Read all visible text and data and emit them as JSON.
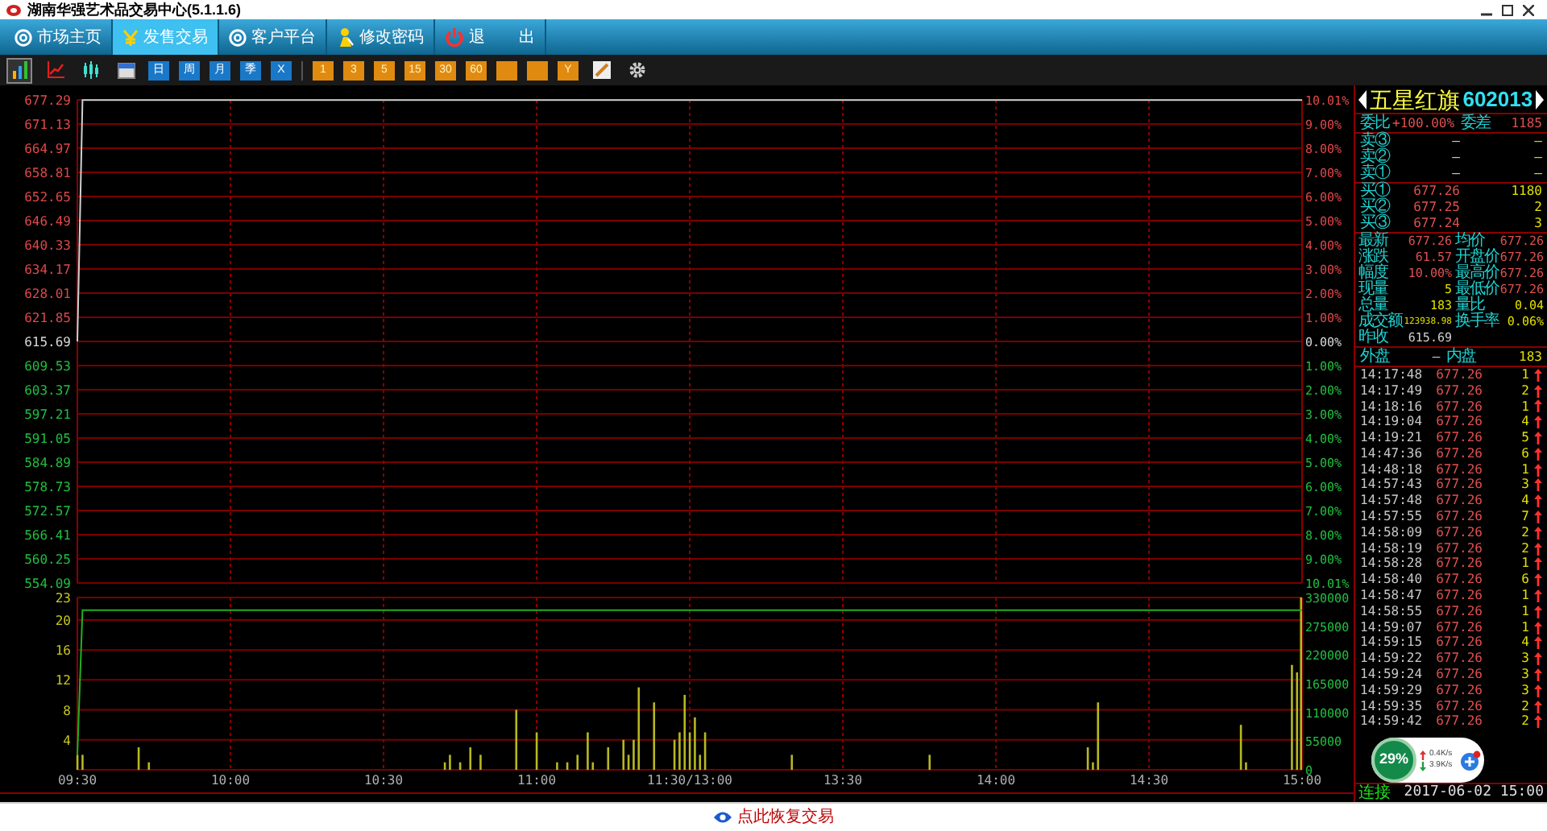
{
  "window": {
    "title": "湖南华强艺术品交易中心(5.1.1.6)"
  },
  "nav": [
    {
      "label": "市场主页",
      "selected": false
    },
    {
      "label": "发售交易",
      "selected": true
    },
    {
      "label": "客户平台",
      "selected": false
    },
    {
      "label": "修改密码",
      "selected": false
    },
    {
      "label": "退 出",
      "selected": false
    }
  ],
  "toolbar": [
    {
      "kind": "bars",
      "selected": true
    },
    {
      "kind": "line",
      "selected": false
    },
    {
      "kind": "candles",
      "selected": false
    },
    {
      "kind": "calendar",
      "selected": false
    },
    {
      "kind": "blue",
      "label": "日",
      "selected": false
    },
    {
      "kind": "blue",
      "label": "周",
      "selected": false
    },
    {
      "kind": "blue",
      "label": "月",
      "selected": false
    },
    {
      "kind": "blue",
      "label": "季",
      "selected": false
    },
    {
      "kind": "blue",
      "label": "X",
      "selected": false
    },
    {
      "kind": "orange",
      "label": "1",
      "selected": false
    },
    {
      "kind": "orange",
      "label": "3",
      "selected": false
    },
    {
      "kind": "orange",
      "label": "5",
      "selected": false
    },
    {
      "kind": "orange",
      "label": "15",
      "selected": false
    },
    {
      "kind": "orange",
      "label": "30",
      "selected": false
    },
    {
      "kind": "orange",
      "label": "60",
      "selected": false
    },
    {
      "kind": "orange",
      "selected": false
    },
    {
      "kind": "orange",
      "selected": false
    },
    {
      "kind": "orange",
      "label": "Y",
      "selected": false
    },
    {
      "kind": "draw",
      "selected": false
    },
    {
      "kind": "gear",
      "selected": false
    }
  ],
  "price_chart": {
    "chart_data": {
      "type": "line",
      "series": [
        {
          "color": "#d0d0d0",
          "values": [
            615.69,
            677.26,
            677.26,
            677.26,
            677.26,
            677.26,
            677.26,
            677.26,
            677.26,
            677.26,
            677.26,
            677.26,
            677.26,
            677.26,
            677.26,
            677.26,
            677.26,
            677.26,
            677.26,
            677.26,
            677.26,
            677.26,
            677.26,
            677.26,
            677.26,
            677.26,
            677.26,
            677.26,
            677.26,
            677.26,
            677.26,
            677.26,
            677.26,
            677.26,
            677.26,
            677.26,
            677.26,
            677.26,
            677.26,
            677.26,
            677.26,
            677.26,
            677.26,
            677.26,
            677.26,
            677.26,
            677.26,
            677.26,
            677.26,
            677.26,
            677.26,
            677.26,
            677.26,
            677.26,
            677.26,
            677.26,
            677.26,
            677.26,
            677.26,
            677.26,
            677.26,
            677.26,
            677.26,
            677.26,
            677.26,
            677.26,
            677.26,
            677.26,
            677.26,
            677.26,
            677.26,
            677.26,
            677.26,
            677.26,
            677.26,
            677.26,
            677.26,
            677.26,
            677.26,
            677.26,
            677.26,
            677.26,
            677.26,
            677.26,
            677.26,
            677.26,
            677.26,
            677.26,
            677.26,
            677.26,
            677.26,
            677.26,
            677.26,
            677.26,
            677.26,
            677.26,
            677.26,
            677.26,
            677.26,
            677.26,
            677.26,
            677.26,
            677.26,
            677.26,
            677.26,
            677.26,
            677.26,
            677.26,
            677.26,
            677.26,
            677.26,
            677.26,
            677.26,
            677.26,
            677.26,
            677.26,
            677.26,
            677.26,
            677.26,
            677.26,
            677.26,
            677.26,
            677.26,
            677.26,
            677.26,
            677.26,
            677.26,
            677.26,
            677.26,
            677.26,
            677.26,
            677.26,
            677.26,
            677.26,
            677.26,
            677.26,
            677.26,
            677.26,
            677.26,
            677.26,
            677.26,
            677.26,
            677.26,
            677.26,
            677.26,
            677.26,
            677.26,
            677.26,
            677.26,
            677.26,
            677.26,
            677.26,
            677.26,
            677.26,
            677.26,
            677.26,
            677.26,
            677.26,
            677.26,
            677.26,
            677.26,
            677.26,
            677.26,
            677.26,
            677.26,
            677.26,
            677.26,
            677.26,
            677.26,
            677.26,
            677.26,
            677.26,
            677.26,
            677.26,
            677.26,
            677.26,
            677.26,
            677.26,
            677.26,
            677.26,
            677.26,
            677.26,
            677.26,
            677.26,
            677.26,
            677.26,
            677.26,
            677.26,
            677.26,
            677.26,
            677.26,
            677.26,
            677.26,
            677.26,
            677.26,
            677.26,
            677.26,
            677.26,
            677.26,
            677.26,
            677.26,
            677.26,
            677.26,
            677.26,
            677.26,
            677.26,
            677.26,
            677.26,
            677.26,
            677.26,
            677.26,
            677.26,
            677.26,
            677.26,
            677.26,
            677.26,
            677.26,
            677.26,
            677.26,
            677.26,
            677.26,
            677.26,
            677.26,
            677.26,
            677.26,
            677.26,
            677.26,
            677.26,
            677.26,
            677.26,
            677.26,
            677.26,
            677.26,
            677.26,
            677.26,
            677.26,
            677.26,
            677.26,
            677.26,
            677.26,
            677.26
          ]
        }
      ],
      "ylim": [
        554.09,
        677.29
      ],
      "grid": true,
      "yticks": [
        {
          "value": 677.29,
          "label": "677.29"
        },
        {
          "value": 671.13,
          "label": "671.13"
        },
        {
          "value": 664.97,
          "label": "664.97"
        },
        {
          "value": 658.81,
          "label": "658.81"
        },
        {
          "value": 652.65,
          "label": "652.65"
        },
        {
          "value": 646.49,
          "label": "646.49"
        },
        {
          "value": 640.33,
          "label": "640.33"
        },
        {
          "value": 634.17,
          "label": "634.17"
        },
        {
          "value": 628.01,
          "label": "628.01"
        },
        {
          "value": 621.85,
          "label": "621.85"
        },
        {
          "value": 615.69,
          "label": "615.69"
        },
        {
          "value": 609.53,
          "label": "609.53"
        },
        {
          "value": 603.37,
          "label": "603.37"
        },
        {
          "value": 597.21,
          "label": "597.21"
        },
        {
          "value": 591.05,
          "label": "591.05"
        },
        {
          "value": 584.89,
          "label": "584.89"
        },
        {
          "value": 578.73,
          "label": "578.73"
        },
        {
          "value": 572.57,
          "label": "572.57"
        },
        {
          "value": 566.41,
          "label": "566.41"
        },
        {
          "value": 560.25,
          "label": "560.25"
        },
        {
          "value": 554.09,
          "label": "554.09"
        }
      ]
    },
    "right_axis": [
      "10.01%",
      "9.00%",
      "8.00%",
      "7.00%",
      "6.00%",
      "5.00%",
      "4.00%",
      "3.00%",
      "2.00%",
      "1.00%",
      "0.00%",
      "1.00%",
      "2.00%",
      "3.00%",
      "4.00%",
      "5.00%",
      "6.00%",
      "7.00%",
      "8.00%",
      "9.00%",
      "10.01%"
    ]
  },
  "volume_chart": {
    "chart_data": {
      "type": "bar",
      "categories": [
        "09:30",
        null,
        null,
        null,
        null,
        null,
        null,
        null,
        null,
        null,
        null,
        null,
        null,
        null,
        null,
        null,
        null,
        null,
        null,
        null,
        null,
        null,
        null,
        null,
        null,
        null,
        null,
        null,
        null,
        null,
        "10:00",
        null,
        null,
        null,
        null,
        null,
        null,
        null,
        null,
        null,
        null,
        null,
        null,
        null,
        null,
        null,
        null,
        null,
        null,
        null,
        null,
        null,
        null,
        null,
        null,
        null,
        null,
        null,
        null,
        null,
        "10:30",
        null,
        null,
        null,
        null,
        null,
        null,
        null,
        null,
        null,
        null,
        null,
        null,
        null,
        null,
        null,
        null,
        null,
        null,
        null,
        null,
        null,
        null,
        null,
        null,
        null,
        null,
        null,
        null,
        null,
        "11:00",
        null,
        null,
        null,
        null,
        null,
        null,
        null,
        null,
        null,
        null,
        null,
        null,
        null,
        null,
        null,
        null,
        null,
        null,
        null,
        null,
        null,
        null,
        null,
        null,
        null,
        null,
        null,
        null,
        null,
        "11:30/13:00",
        null,
        null,
        null,
        null,
        null,
        null,
        null,
        null,
        null,
        null,
        null,
        null,
        null,
        null,
        null,
        null,
        null,
        null,
        null,
        null,
        null,
        null,
        null,
        null,
        null,
        null,
        null,
        null,
        null,
        "13:30",
        null,
        null,
        null,
        null,
        null,
        null,
        null,
        null,
        null,
        null,
        null,
        null,
        null,
        null,
        null,
        null,
        null,
        null,
        null,
        null,
        null,
        null,
        null,
        null,
        null,
        null,
        null,
        null,
        null,
        "14:00",
        null,
        null,
        null,
        null,
        null,
        null,
        null,
        null,
        null,
        null,
        null,
        null,
        null,
        null,
        null,
        null,
        null,
        null,
        null,
        null,
        null,
        null,
        null,
        null,
        null,
        null,
        null,
        null,
        null,
        "14:30",
        null,
        null,
        null,
        null,
        null,
        null,
        null,
        null,
        null,
        null,
        null,
        null,
        null,
        null,
        null,
        null,
        null,
        null,
        null,
        null,
        null,
        null,
        null,
        null,
        null,
        null,
        null,
        null,
        null,
        "15:00"
      ],
      "series": [
        {
          "type": "bar",
          "color": "#b8b820",
          "values": [
            2,
            2,
            null,
            null,
            null,
            null,
            null,
            null,
            null,
            null,
            null,
            null,
            3,
            null,
            1,
            null,
            null,
            null,
            null,
            null,
            null,
            null,
            null,
            null,
            null,
            null,
            null,
            null,
            null,
            null,
            null,
            null,
            null,
            null,
            null,
            null,
            null,
            null,
            null,
            null,
            null,
            null,
            null,
            null,
            null,
            null,
            null,
            null,
            null,
            null,
            null,
            null,
            null,
            null,
            null,
            null,
            null,
            null,
            null,
            null,
            null,
            null,
            null,
            null,
            null,
            null,
            null,
            null,
            null,
            null,
            null,
            null,
            1,
            2,
            null,
            1,
            null,
            3,
            null,
            2,
            null,
            null,
            null,
            null,
            null,
            null,
            8,
            null,
            null,
            null,
            5,
            null,
            null,
            null,
            1,
            null,
            1,
            null,
            2,
            null,
            5,
            1,
            null,
            null,
            3,
            null,
            null,
            4,
            2,
            4,
            11,
            null,
            null,
            9,
            null,
            null,
            null,
            4,
            5,
            10,
            5,
            7,
            2,
            5,
            null,
            null,
            null,
            null,
            null,
            null,
            null,
            null,
            null,
            null,
            null,
            null,
            null,
            null,
            null,
            null,
            2,
            null,
            null,
            null,
            null,
            null,
            null,
            null,
            null,
            null,
            null,
            null,
            null,
            null,
            null,
            null,
            null,
            null,
            null,
            null,
            null,
            null,
            null,
            null,
            null,
            null,
            null,
            2,
            null,
            null,
            null,
            null,
            null,
            null,
            null,
            null,
            null,
            null,
            null,
            null,
            null,
            null,
            null,
            null,
            null,
            null,
            null,
            null,
            null,
            null,
            null,
            null,
            null,
            null,
            null,
            null,
            null,
            null,
            3,
            1,
            9,
            null,
            null,
            null,
            null,
            null,
            null,
            null,
            null,
            null,
            null,
            null,
            null,
            null,
            null,
            null,
            null,
            null,
            null,
            null,
            null,
            null,
            null,
            null,
            null,
            null,
            null,
            null,
            6,
            1,
            null,
            null,
            null,
            null,
            null,
            null,
            null,
            null,
            14,
            13,
            23
          ]
        },
        {
          "type": "line",
          "color": "#20b020",
          "values": [
            2,
            21.3,
            21.3,
            21.3,
            21.3,
            21.3,
            21.3,
            21.3,
            21.3,
            21.3,
            21.3,
            21.3,
            21.3,
            21.3,
            21.3,
            21.3,
            21.3,
            21.3,
            21.3,
            21.3,
            21.3,
            21.3,
            21.3,
            21.3,
            21.3,
            21.3,
            21.3,
            21.3,
            21.3,
            21.3,
            21.3,
            21.3,
            21.3,
            21.3,
            21.3,
            21.3,
            21.3,
            21.3,
            21.3,
            21.3,
            21.3,
            21.3,
            21.3,
            21.3,
            21.3,
            21.3,
            21.3,
            21.3,
            21.3,
            21.3,
            21.3,
            21.3,
            21.3,
            21.3,
            21.3,
            21.3,
            21.3,
            21.3,
            21.3,
            21.3,
            21.3,
            21.3,
            21.3,
            21.3,
            21.3,
            21.3,
            21.3,
            21.3,
            21.3,
            21.3,
            21.3,
            21.3,
            21.3,
            21.3,
            21.3,
            21.3,
            21.3,
            21.3,
            21.3,
            21.3,
            21.3,
            21.3,
            21.3,
            21.3,
            21.3,
            21.3,
            21.3,
            21.3,
            21.3,
            21.3,
            21.3,
            21.3,
            21.3,
            21.3,
            21.3,
            21.3,
            21.3,
            21.3,
            21.3,
            21.3,
            21.3,
            21.3,
            21.3,
            21.3,
            21.3,
            21.3,
            21.3,
            21.3,
            21.3,
            21.3,
            21.3,
            21.3,
            21.3,
            21.3,
            21.3,
            21.3,
            21.3,
            21.3,
            21.3,
            21.3,
            21.3,
            21.3,
            21.3,
            21.3,
            21.3,
            21.3,
            21.3,
            21.3,
            21.3,
            21.3,
            21.3,
            21.3,
            21.3,
            21.3,
            21.3,
            21.3,
            21.3,
            21.3,
            21.3,
            21.3,
            21.3,
            21.3,
            21.3,
            21.3,
            21.3,
            21.3,
            21.3,
            21.3,
            21.3,
            21.3,
            21.3,
            21.3,
            21.3,
            21.3,
            21.3,
            21.3,
            21.3,
            21.3,
            21.3,
            21.3,
            21.3,
            21.3,
            21.3,
            21.3,
            21.3,
            21.3,
            21.3,
            21.3,
            21.3,
            21.3,
            21.3,
            21.3,
            21.3,
            21.3,
            21.3,
            21.3,
            21.3,
            21.3,
            21.3,
            21.3,
            21.3,
            21.3,
            21.3,
            21.3,
            21.3,
            21.3,
            21.3,
            21.3,
            21.3,
            21.3,
            21.3,
            21.3,
            21.3,
            21.3,
            21.3,
            21.3,
            21.3,
            21.3,
            21.3,
            21.3,
            21.3,
            21.3,
            21.3,
            21.3,
            21.3,
            21.3,
            21.3,
            21.3,
            21.3,
            21.3,
            21.3,
            21.3,
            21.3,
            21.3,
            21.3,
            21.3,
            21.3,
            21.3,
            21.3,
            21.3,
            21.3,
            21.3,
            21.3,
            21.3,
            21.3,
            21.3,
            21.3,
            21.3,
            21.3,
            21.3,
            21.3,
            21.3,
            21.3,
            21.3,
            21.3,
            21.3,
            21.3,
            21.3,
            21.3,
            21.3,
            21.3
          ]
        }
      ],
      "grid": true,
      "ylim": [
        0,
        23
      ],
      "yticks": [
        4,
        8,
        12,
        16,
        20,
        23
      ]
    },
    "right_axis": [
      "330000",
      "275000",
      "220000",
      "165000",
      "110000",
      "55000",
      "0"
    ]
  },
  "quote": {
    "name": "五星红旗",
    "code": "602013",
    "ratio": [
      {
        "label": "委比",
        "value": "+100.00%"
      },
      {
        "label": "委差",
        "value": "1185"
      }
    ],
    "asks": [
      {
        "label": "卖③",
        "price": "—",
        "volume": "—"
      },
      {
        "label": "卖②",
        "price": "—",
        "volume": "—"
      },
      {
        "label": "卖①",
        "price": "—",
        "volume": "—"
      }
    ],
    "bids": [
      {
        "label": "买①",
        "price": "677.26",
        "volume": "1180"
      },
      {
        "label": "买②",
        "price": "677.25",
        "volume": "2"
      },
      {
        "label": "买③",
        "price": "677.24",
        "volume": "3"
      }
    ],
    "fields": [
      [
        {
          "label": "最新",
          "value": "677.26",
          "kind": "price"
        },
        {
          "label": "均价",
          "value": "677.26",
          "kind": "price"
        }
      ],
      [
        {
          "label": "涨跌",
          "value": "61.57",
          "kind": "price"
        },
        {
          "label": "开盘价",
          "value": "677.26",
          "kind": "price"
        }
      ],
      [
        {
          "label": "幅度",
          "value": "10.00%",
          "kind": "price"
        },
        {
          "label": "最高价",
          "value": "677.26",
          "kind": "price"
        }
      ],
      [
        {
          "label": "现量",
          "value": "5",
          "kind": "volume"
        },
        {
          "label": "最低价",
          "value": "677.26",
          "kind": "price"
        }
      ],
      [
        {
          "label": "总量",
          "value": "183",
          "kind": "volume"
        },
        {
          "label": "量比",
          "value": "0.04",
          "kind": "volume"
        }
      ],
      [
        {
          "label": "成交额",
          "value": "123938.98",
          "kind": "tiny"
        },
        {
          "label": "换手率",
          "value": "0.06%",
          "kind": "volume"
        }
      ],
      [
        {
          "label": "昨收",
          "value": "615.69",
          "kind": "plain"
        }
      ]
    ],
    "outer_inner": [
      {
        "label": "外盘",
        "value": "—"
      },
      {
        "label": "内盘",
        "value": "183"
      }
    ],
    "ticks": [
      {
        "time": "14:17:48",
        "price": "677.26",
        "volume": "1"
      },
      {
        "time": "14:17:49",
        "price": "677.26",
        "volume": "2"
      },
      {
        "time": "14:18:16",
        "price": "677.26",
        "volume": "1"
      },
      {
        "time": "14:19:04",
        "price": "677.26",
        "volume": "4"
      },
      {
        "time": "14:19:21",
        "price": "677.26",
        "volume": "5"
      },
      {
        "time": "14:47:36",
        "price": "677.26",
        "volume": "6"
      },
      {
        "time": "14:48:18",
        "price": "677.26",
        "volume": "1"
      },
      {
        "time": "14:57:43",
        "price": "677.26",
        "volume": "3"
      },
      {
        "time": "14:57:48",
        "price": "677.26",
        "volume": "4"
      },
      {
        "time": "14:57:55",
        "price": "677.26",
        "volume": "7"
      },
      {
        "time": "14:58:09",
        "price": "677.26",
        "volume": "2"
      },
      {
        "time": "14:58:19",
        "price": "677.26",
        "volume": "2"
      },
      {
        "time": "14:58:28",
        "price": "677.26",
        "volume": "1"
      },
      {
        "time": "14:58:40",
        "price": "677.26",
        "volume": "6"
      },
      {
        "time": "14:58:47",
        "price": "677.26",
        "volume": "1"
      },
      {
        "time": "14:58:55",
        "price": "677.26",
        "volume": "1"
      },
      {
        "time": "14:59:07",
        "price": "677.26",
        "volume": "1"
      },
      {
        "time": "14:59:15",
        "price": "677.26",
        "volume": "4"
      },
      {
        "time": "14:59:22",
        "price": "677.26",
        "volume": "3"
      },
      {
        "time": "14:59:24",
        "price": "677.26",
        "volume": "3"
      },
      {
        "time": "14:59:29",
        "price": "677.26",
        "volume": "3"
      },
      {
        "time": "14:59:35",
        "price": "677.26",
        "volume": "2"
      },
      {
        "time": "14:59:42",
        "price": "677.26",
        "volume": "2"
      }
    ]
  },
  "status": {
    "connection": "连接",
    "datetime": "2017-06-02 15:00"
  },
  "speed_widget": {
    "percent": "29%",
    "upload": "0.4K/s",
    "download": "3.9K/s"
  },
  "footer": {
    "label": "点此恢复交易"
  }
}
